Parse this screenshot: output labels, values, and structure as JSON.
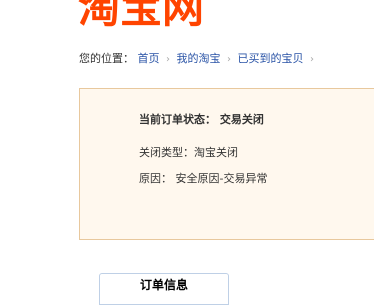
{
  "logo": {
    "text": "淘宝网",
    "color": "#ff4400"
  },
  "breadcrumb": {
    "prefix": "您的位置：",
    "items": [
      "首页",
      "我的淘宝",
      "已买到的宝贝"
    ],
    "separator": "›"
  },
  "order_status": {
    "title_label": "当前订单状态：",
    "title_value": "交易关闭",
    "close_type_label": "关闭类型：",
    "close_type_value": "淘宝关闭",
    "reason_label": "原因：",
    "reason_value": "安全原因-交易异常"
  },
  "tabs": [
    {
      "label": "订单信息"
    }
  ]
}
